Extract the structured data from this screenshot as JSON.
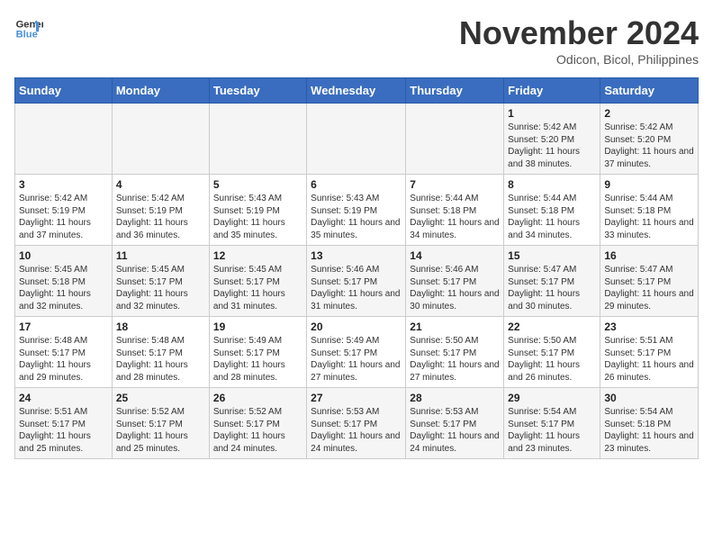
{
  "header": {
    "logo_line1": "General",
    "logo_line2": "Blue",
    "month": "November 2024",
    "location": "Odicon, Bicol, Philippines"
  },
  "weekdays": [
    "Sunday",
    "Monday",
    "Tuesday",
    "Wednesday",
    "Thursday",
    "Friday",
    "Saturday"
  ],
  "weeks": [
    [
      {
        "day": "",
        "info": ""
      },
      {
        "day": "",
        "info": ""
      },
      {
        "day": "",
        "info": ""
      },
      {
        "day": "",
        "info": ""
      },
      {
        "day": "",
        "info": ""
      },
      {
        "day": "1",
        "info": "Sunrise: 5:42 AM\nSunset: 5:20 PM\nDaylight: 11 hours and 38 minutes."
      },
      {
        "day": "2",
        "info": "Sunrise: 5:42 AM\nSunset: 5:20 PM\nDaylight: 11 hours and 37 minutes."
      }
    ],
    [
      {
        "day": "3",
        "info": "Sunrise: 5:42 AM\nSunset: 5:19 PM\nDaylight: 11 hours and 37 minutes."
      },
      {
        "day": "4",
        "info": "Sunrise: 5:42 AM\nSunset: 5:19 PM\nDaylight: 11 hours and 36 minutes."
      },
      {
        "day": "5",
        "info": "Sunrise: 5:43 AM\nSunset: 5:19 PM\nDaylight: 11 hours and 35 minutes."
      },
      {
        "day": "6",
        "info": "Sunrise: 5:43 AM\nSunset: 5:19 PM\nDaylight: 11 hours and 35 minutes."
      },
      {
        "day": "7",
        "info": "Sunrise: 5:44 AM\nSunset: 5:18 PM\nDaylight: 11 hours and 34 minutes."
      },
      {
        "day": "8",
        "info": "Sunrise: 5:44 AM\nSunset: 5:18 PM\nDaylight: 11 hours and 34 minutes."
      },
      {
        "day": "9",
        "info": "Sunrise: 5:44 AM\nSunset: 5:18 PM\nDaylight: 11 hours and 33 minutes."
      }
    ],
    [
      {
        "day": "10",
        "info": "Sunrise: 5:45 AM\nSunset: 5:18 PM\nDaylight: 11 hours and 32 minutes."
      },
      {
        "day": "11",
        "info": "Sunrise: 5:45 AM\nSunset: 5:17 PM\nDaylight: 11 hours and 32 minutes."
      },
      {
        "day": "12",
        "info": "Sunrise: 5:45 AM\nSunset: 5:17 PM\nDaylight: 11 hours and 31 minutes."
      },
      {
        "day": "13",
        "info": "Sunrise: 5:46 AM\nSunset: 5:17 PM\nDaylight: 11 hours and 31 minutes."
      },
      {
        "day": "14",
        "info": "Sunrise: 5:46 AM\nSunset: 5:17 PM\nDaylight: 11 hours and 30 minutes."
      },
      {
        "day": "15",
        "info": "Sunrise: 5:47 AM\nSunset: 5:17 PM\nDaylight: 11 hours and 30 minutes."
      },
      {
        "day": "16",
        "info": "Sunrise: 5:47 AM\nSunset: 5:17 PM\nDaylight: 11 hours and 29 minutes."
      }
    ],
    [
      {
        "day": "17",
        "info": "Sunrise: 5:48 AM\nSunset: 5:17 PM\nDaylight: 11 hours and 29 minutes."
      },
      {
        "day": "18",
        "info": "Sunrise: 5:48 AM\nSunset: 5:17 PM\nDaylight: 11 hours and 28 minutes."
      },
      {
        "day": "19",
        "info": "Sunrise: 5:49 AM\nSunset: 5:17 PM\nDaylight: 11 hours and 28 minutes."
      },
      {
        "day": "20",
        "info": "Sunrise: 5:49 AM\nSunset: 5:17 PM\nDaylight: 11 hours and 27 minutes."
      },
      {
        "day": "21",
        "info": "Sunrise: 5:50 AM\nSunset: 5:17 PM\nDaylight: 11 hours and 27 minutes."
      },
      {
        "day": "22",
        "info": "Sunrise: 5:50 AM\nSunset: 5:17 PM\nDaylight: 11 hours and 26 minutes."
      },
      {
        "day": "23",
        "info": "Sunrise: 5:51 AM\nSunset: 5:17 PM\nDaylight: 11 hours and 26 minutes."
      }
    ],
    [
      {
        "day": "24",
        "info": "Sunrise: 5:51 AM\nSunset: 5:17 PM\nDaylight: 11 hours and 25 minutes."
      },
      {
        "day": "25",
        "info": "Sunrise: 5:52 AM\nSunset: 5:17 PM\nDaylight: 11 hours and 25 minutes."
      },
      {
        "day": "26",
        "info": "Sunrise: 5:52 AM\nSunset: 5:17 PM\nDaylight: 11 hours and 24 minutes."
      },
      {
        "day": "27",
        "info": "Sunrise: 5:53 AM\nSunset: 5:17 PM\nDaylight: 11 hours and 24 minutes."
      },
      {
        "day": "28",
        "info": "Sunrise: 5:53 AM\nSunset: 5:17 PM\nDaylight: 11 hours and 24 minutes."
      },
      {
        "day": "29",
        "info": "Sunrise: 5:54 AM\nSunset: 5:17 PM\nDaylight: 11 hours and 23 minutes."
      },
      {
        "day": "30",
        "info": "Sunrise: 5:54 AM\nSunset: 5:18 PM\nDaylight: 11 hours and 23 minutes."
      }
    ]
  ]
}
